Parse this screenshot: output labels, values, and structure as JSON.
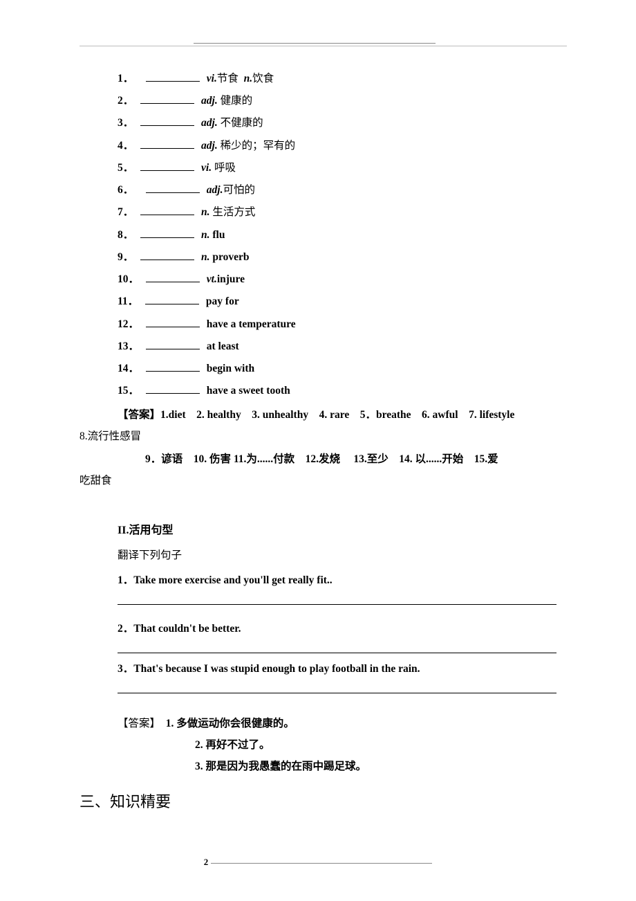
{
  "items": [
    {
      "num": "1",
      "pos": "vi.",
      "def": "节食",
      "extra_pos": "n.",
      "extra_def": "饮食"
    },
    {
      "num": "2",
      "pos": "adj.",
      "def": "健康的"
    },
    {
      "num": "3",
      "pos": "adj.",
      "def": "不健康的"
    },
    {
      "num": "4",
      "pos": "adj.",
      "def": "稀少的；罕有的"
    },
    {
      "num": "5",
      "pos": "vi.",
      "def": "呼吸"
    },
    {
      "num": "6",
      "pos": "adj.",
      "def": "可怕的"
    },
    {
      "num": "7",
      "pos": "n.",
      "def": "生活方式"
    },
    {
      "num": "8",
      "pos": "n.",
      "def_bold": "flu"
    },
    {
      "num": "9",
      "pos": "n.",
      "def_bold": "proverb"
    },
    {
      "num": "10",
      "pos": "vt.",
      "def_bold": "injure"
    },
    {
      "num": "11",
      "def_bold": "pay for"
    },
    {
      "num": "12",
      "def_bold": "have a temperature"
    },
    {
      "num": "13",
      "def_bold": "at least"
    },
    {
      "num": "14",
      "def_bold": "begin with"
    },
    {
      "num": "15",
      "def_bold": "have a sweet tooth"
    }
  ],
  "answers1": {
    "label": "【答案】",
    "line1_parts": [
      {
        "k": "1.",
        "v": "diet"
      },
      {
        "k": "2.",
        "v": "healthy"
      },
      {
        "k": "3.",
        "v": "unhealthy"
      },
      {
        "k": "4.",
        "v": "rare"
      },
      {
        "k": "5．",
        "v": "breathe"
      },
      {
        "k": "6.",
        "v": "awful"
      },
      {
        "k": "7.",
        "v": "lifestyle"
      }
    ],
    "line1_tail": "8.流行性感冒",
    "line2": "9．谚语　10. 伤害 11.为......付款　12.发烧　 13.至少　14. 以......开始　15.爱",
    "line3": "吃甜食"
  },
  "section2": {
    "title": "II.活用句型",
    "subtitle": "翻译下列句子",
    "questions": [
      "1．Take more exercise and you'll get really fit..",
      "2．That couldn't be better.",
      "3．That's because I was stupid enough to play football in the rain."
    ]
  },
  "answers2": {
    "label": "【答案】",
    "lines": [
      "1. 多做运动你会很健康的。",
      "2. 再好不过了。",
      "3. 那是因为我愚蠢的在雨中踢足球。"
    ]
  },
  "section3_title": "三、知识精要",
  "page_number": "2"
}
